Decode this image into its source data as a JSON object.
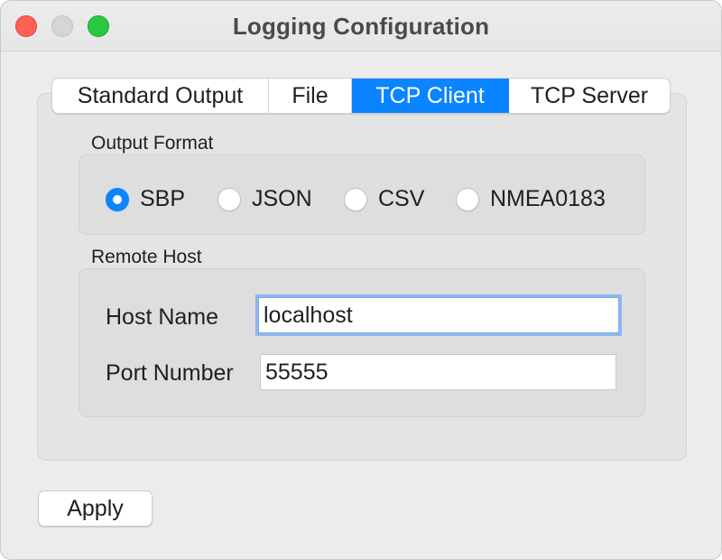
{
  "window": {
    "title": "Logging Configuration"
  },
  "tabs": [
    {
      "label": "Standard Output",
      "active": false
    },
    {
      "label": "File",
      "active": false
    },
    {
      "label": "TCP Client",
      "active": true
    },
    {
      "label": "TCP Server",
      "active": false
    }
  ],
  "output_format": {
    "label": "Output Format",
    "options": [
      {
        "label": "SBP",
        "checked": true
      },
      {
        "label": "JSON",
        "checked": false
      },
      {
        "label": "CSV",
        "checked": false
      },
      {
        "label": "NMEA0183",
        "checked": false
      }
    ]
  },
  "remote_host": {
    "label": "Remote Host",
    "host_name_label": "Host Name",
    "host_name_value": "localhost",
    "port_number_label": "Port Number",
    "port_number_value": "55555"
  },
  "actions": {
    "apply_label": "Apply"
  },
  "colors": {
    "accent": "#0a84ff",
    "close": "#fe5f57",
    "zoom": "#28c840",
    "minimize_inactive": "#d5d5d5"
  }
}
